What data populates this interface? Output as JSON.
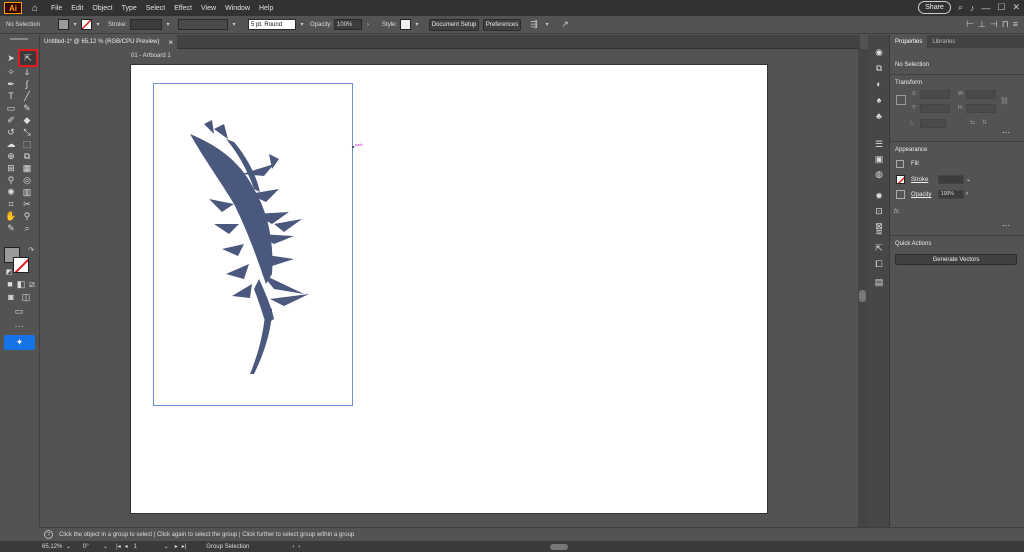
{
  "app": {
    "logo": "Ai"
  },
  "menu": [
    "File",
    "Edit",
    "Object",
    "Type",
    "Select",
    "Effect",
    "View",
    "Window",
    "Help"
  ],
  "top_right": {
    "share_label": "Share"
  },
  "control": {
    "selection_status": "No Selection",
    "stroke_label": "Stroke:",
    "brush_value": "5 pt. Round",
    "opacity_label": "Opacity:",
    "opacity_value": "100%",
    "style_label": "Style:",
    "document_setup": "Document Setup",
    "preferences": "Preferences"
  },
  "document": {
    "tab_title": "Untitled-1* @ 65,12 % (RGB/CPU Preview)",
    "close_glyph": "×",
    "artboard_label": "01 - Artboard 1"
  },
  "properties": {
    "tabs": [
      "Properties",
      "Libraries"
    ],
    "selection": "No Selection",
    "transform": {
      "title": "Transform",
      "x_label": "X:",
      "y_label": "Y:",
      "w_label": "W:",
      "h_label": "H:"
    },
    "appearance": {
      "title": "Appearance",
      "fill_label": "Fill",
      "stroke_label": "Stroke",
      "opacity_label": "Opacity",
      "opacity_value": "100%",
      "fx_label": "fx."
    },
    "quick_actions": {
      "title": "Quick Actions",
      "generate_vectors": "Generate Vectors"
    }
  },
  "hint": "Click the object in a group to select  |  Click again to select the group  |  Click further to select group within a group",
  "status": {
    "zoom": "65,12%",
    "rotation": "0°",
    "artboard_number": "1",
    "tool_name": "Group Selection"
  },
  "colors": {
    "accent": "#1473e6",
    "highlight": "#e01b1b",
    "feather": "#3c4a72"
  }
}
